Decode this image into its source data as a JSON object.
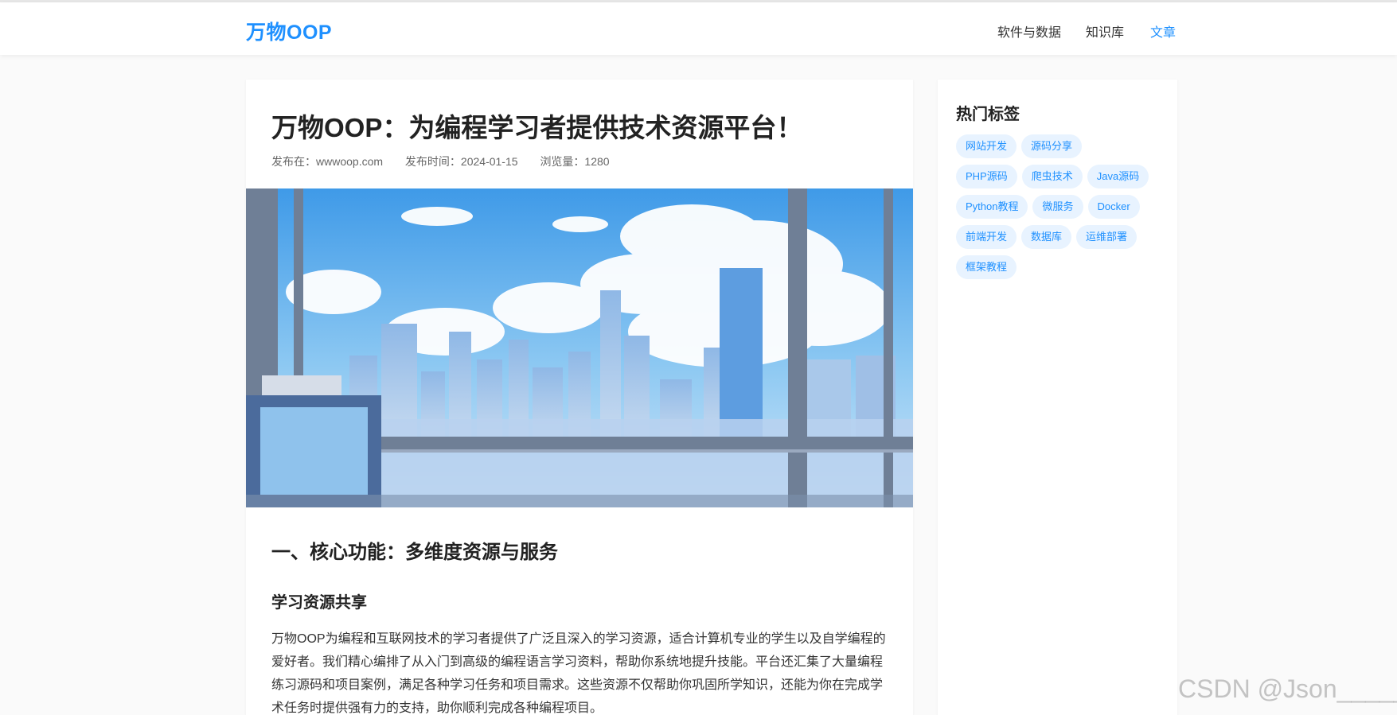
{
  "header": {
    "logo": "万物OOP",
    "nav": [
      {
        "label": "软件与数据"
      },
      {
        "label": "知识库"
      },
      {
        "label": "文章"
      }
    ]
  },
  "article": {
    "title": "万物OOP：为编程学习者提供技术资源平台！",
    "meta": {
      "source": "发布在：wwwoop.com",
      "date": "发布时间：2024-01-15",
      "views": "浏览量：1280"
    },
    "h2": "一、核心功能：多维度资源与服务",
    "h3": "学习资源共享",
    "paragraph": "万物OOP为编程和互联网技术的学习者提供了广泛且深入的学习资源，适合计算机专业的学生以及自学编程的爱好者。我们精心编排了从入门到高级的编程语言学习资料，帮助你系统地提升技能。平台还汇集了大量编程练习源码和项目案例，满足各种学习任务和项目需求。这些资源不仅帮助你巩固所学知识，还能为你在完成学术任务时提供强有力的支持，助你顺利完成各种编程项目。"
  },
  "sidebar": {
    "title": "热门标签",
    "tags": [
      "网站开发",
      "源码分享",
      "PHP源码",
      "爬虫技术",
      "Java源码",
      "Python教程",
      "微服务",
      "Docker",
      "前端开发",
      "数据库",
      "运维部署",
      "框架教程"
    ]
  },
  "watermark": "CSDN @Json_____",
  "colors": {
    "accent": "#1e90ff",
    "tag_bg": "#e8f3ff"
  }
}
